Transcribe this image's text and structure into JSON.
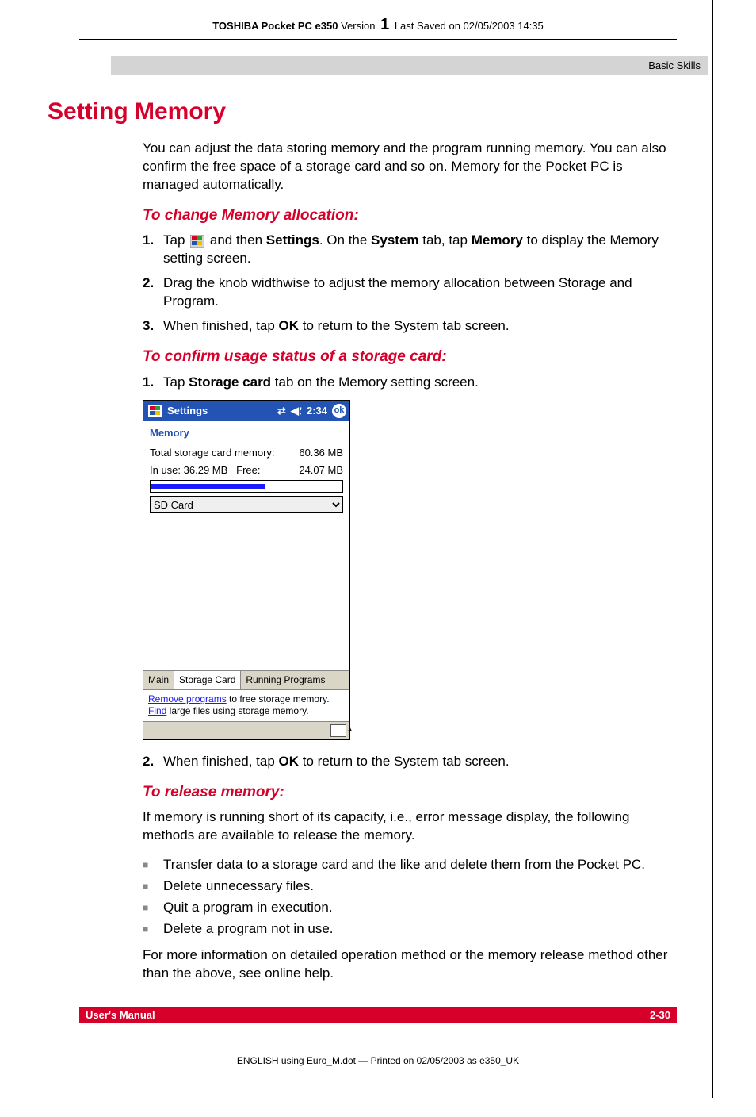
{
  "header": {
    "product": "TOSHIBA Pocket PC e350",
    "version_label": "Version",
    "version": "1",
    "saved": "Last Saved on 02/05/2003 14:35"
  },
  "section_bar": "Basic Skills",
  "title": "Setting Memory",
  "intro": "You can adjust the data storing memory and the program running memory. You can also confirm the free space of a storage card and so on. Memory for the Pocket PC is managed automatically.",
  "sub1": "To change Memory allocation:",
  "step1a_pre": "Tap ",
  "step1a_post": " and then ",
  "step1a_settings": "Settings",
  "step1a_mid": ". On the ",
  "step1a_system": "System",
  "step1a_mid2": " tab, tap ",
  "step1a_memory": "Memory",
  "step1a_end": " to display the Memory setting screen.",
  "step2a": "Drag the knob widthwise to adjust the memory allocation between Storage and Program.",
  "step3a_pre": "When finished, tap ",
  "step3a_ok": "OK",
  "step3a_post": " to return to the System tab screen.",
  "sub2": "To confirm usage status of a storage card:",
  "step1b_pre": "Tap ",
  "step1b_sc": "Storage card",
  "step1b_post": " tab on the Memory setting screen.",
  "pda": {
    "title": "Settings",
    "time": "2:34",
    "ok": "ok",
    "memory": "Memory",
    "total_label": "Total storage card memory:",
    "total_value": "60.36 MB",
    "inuse_label": "In use:",
    "inuse_value": "36.29 MB",
    "free_label": "Free:",
    "free_value": "24.07 MB",
    "dropdown": "SD Card",
    "tab_main": "Main",
    "tab_storage": "Storage Card",
    "tab_running": "Running Programs",
    "link_remove": "Remove programs",
    "link_remove_post": " to free storage memory.",
    "link_find": "Find",
    "link_find_post": " large files using storage memory."
  },
  "step2c_pre": "When finished, tap ",
  "step2c_ok": "OK",
  "step2c_post": " to return to the System tab screen.",
  "sub3": "To release memory:",
  "release_intro": "If memory is running short of its capacity, i.e., error message display, the following methods are available to release the memory.",
  "bullets": [
    "Transfer data to a storage card and the like and delete them from the Pocket PC.",
    "Delete unnecessary files.",
    "Quit a program in execution.",
    "Delete a program not in use."
  ],
  "release_outro": "For more information on detailed operation method or the memory release method other than the above, see online help.",
  "footer": {
    "left": "User's Manual",
    "right": "2-30"
  },
  "print_foot": "ENGLISH using Euro_M.dot — Printed on 02/05/2003 as e350_UK"
}
